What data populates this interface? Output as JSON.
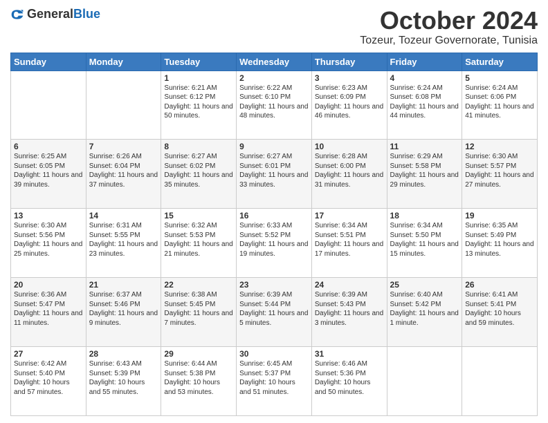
{
  "header": {
    "logo_general": "General",
    "logo_blue": "Blue",
    "month": "October 2024",
    "location": "Tozeur, Tozeur Governorate, Tunisia"
  },
  "days_of_week": [
    "Sunday",
    "Monday",
    "Tuesday",
    "Wednesday",
    "Thursday",
    "Friday",
    "Saturday"
  ],
  "weeks": [
    [
      {
        "day": "",
        "info": ""
      },
      {
        "day": "",
        "info": ""
      },
      {
        "day": "1",
        "info": "Sunrise: 6:21 AM\nSunset: 6:12 PM\nDaylight: 11 hours and 50 minutes."
      },
      {
        "day": "2",
        "info": "Sunrise: 6:22 AM\nSunset: 6:10 PM\nDaylight: 11 hours and 48 minutes."
      },
      {
        "day": "3",
        "info": "Sunrise: 6:23 AM\nSunset: 6:09 PM\nDaylight: 11 hours and 46 minutes."
      },
      {
        "day": "4",
        "info": "Sunrise: 6:24 AM\nSunset: 6:08 PM\nDaylight: 11 hours and 44 minutes."
      },
      {
        "day": "5",
        "info": "Sunrise: 6:24 AM\nSunset: 6:06 PM\nDaylight: 11 hours and 41 minutes."
      }
    ],
    [
      {
        "day": "6",
        "info": "Sunrise: 6:25 AM\nSunset: 6:05 PM\nDaylight: 11 hours and 39 minutes."
      },
      {
        "day": "7",
        "info": "Sunrise: 6:26 AM\nSunset: 6:04 PM\nDaylight: 11 hours and 37 minutes."
      },
      {
        "day": "8",
        "info": "Sunrise: 6:27 AM\nSunset: 6:02 PM\nDaylight: 11 hours and 35 minutes."
      },
      {
        "day": "9",
        "info": "Sunrise: 6:27 AM\nSunset: 6:01 PM\nDaylight: 11 hours and 33 minutes."
      },
      {
        "day": "10",
        "info": "Sunrise: 6:28 AM\nSunset: 6:00 PM\nDaylight: 11 hours and 31 minutes."
      },
      {
        "day": "11",
        "info": "Sunrise: 6:29 AM\nSunset: 5:58 PM\nDaylight: 11 hours and 29 minutes."
      },
      {
        "day": "12",
        "info": "Sunrise: 6:30 AM\nSunset: 5:57 PM\nDaylight: 11 hours and 27 minutes."
      }
    ],
    [
      {
        "day": "13",
        "info": "Sunrise: 6:30 AM\nSunset: 5:56 PM\nDaylight: 11 hours and 25 minutes."
      },
      {
        "day": "14",
        "info": "Sunrise: 6:31 AM\nSunset: 5:55 PM\nDaylight: 11 hours and 23 minutes."
      },
      {
        "day": "15",
        "info": "Sunrise: 6:32 AM\nSunset: 5:53 PM\nDaylight: 11 hours and 21 minutes."
      },
      {
        "day": "16",
        "info": "Sunrise: 6:33 AM\nSunset: 5:52 PM\nDaylight: 11 hours and 19 minutes."
      },
      {
        "day": "17",
        "info": "Sunrise: 6:34 AM\nSunset: 5:51 PM\nDaylight: 11 hours and 17 minutes."
      },
      {
        "day": "18",
        "info": "Sunrise: 6:34 AM\nSunset: 5:50 PM\nDaylight: 11 hours and 15 minutes."
      },
      {
        "day": "19",
        "info": "Sunrise: 6:35 AM\nSunset: 5:49 PM\nDaylight: 11 hours and 13 minutes."
      }
    ],
    [
      {
        "day": "20",
        "info": "Sunrise: 6:36 AM\nSunset: 5:47 PM\nDaylight: 11 hours and 11 minutes."
      },
      {
        "day": "21",
        "info": "Sunrise: 6:37 AM\nSunset: 5:46 PM\nDaylight: 11 hours and 9 minutes."
      },
      {
        "day": "22",
        "info": "Sunrise: 6:38 AM\nSunset: 5:45 PM\nDaylight: 11 hours and 7 minutes."
      },
      {
        "day": "23",
        "info": "Sunrise: 6:39 AM\nSunset: 5:44 PM\nDaylight: 11 hours and 5 minutes."
      },
      {
        "day": "24",
        "info": "Sunrise: 6:39 AM\nSunset: 5:43 PM\nDaylight: 11 hours and 3 minutes."
      },
      {
        "day": "25",
        "info": "Sunrise: 6:40 AM\nSunset: 5:42 PM\nDaylight: 11 hours and 1 minute."
      },
      {
        "day": "26",
        "info": "Sunrise: 6:41 AM\nSunset: 5:41 PM\nDaylight: 10 hours and 59 minutes."
      }
    ],
    [
      {
        "day": "27",
        "info": "Sunrise: 6:42 AM\nSunset: 5:40 PM\nDaylight: 10 hours and 57 minutes."
      },
      {
        "day": "28",
        "info": "Sunrise: 6:43 AM\nSunset: 5:39 PM\nDaylight: 10 hours and 55 minutes."
      },
      {
        "day": "29",
        "info": "Sunrise: 6:44 AM\nSunset: 5:38 PM\nDaylight: 10 hours and 53 minutes."
      },
      {
        "day": "30",
        "info": "Sunrise: 6:45 AM\nSunset: 5:37 PM\nDaylight: 10 hours and 51 minutes."
      },
      {
        "day": "31",
        "info": "Sunrise: 6:46 AM\nSunset: 5:36 PM\nDaylight: 10 hours and 50 minutes."
      },
      {
        "day": "",
        "info": ""
      },
      {
        "day": "",
        "info": ""
      }
    ]
  ]
}
